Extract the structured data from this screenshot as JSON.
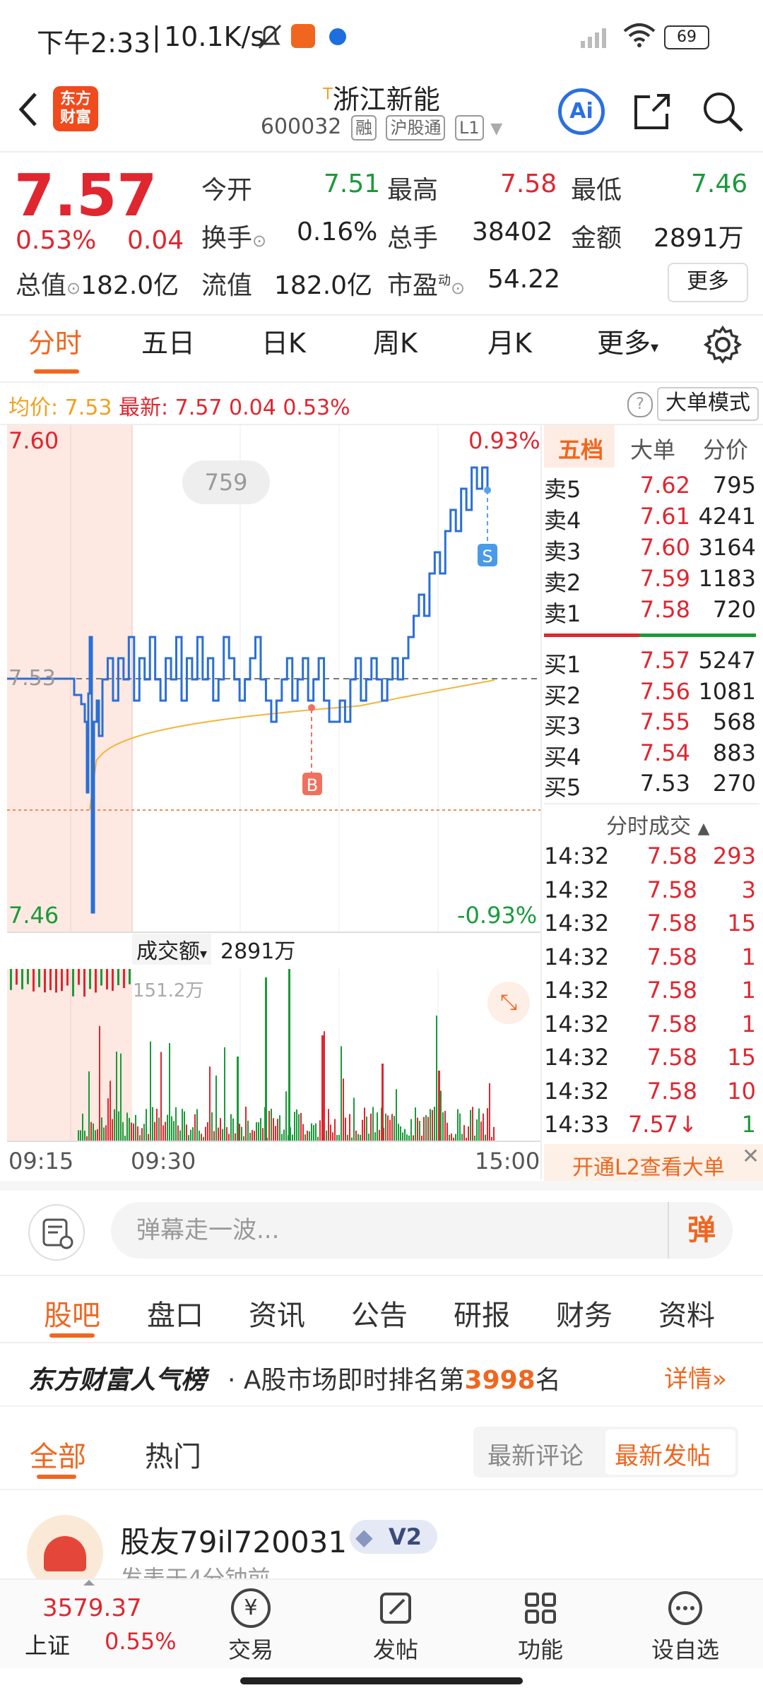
{
  "status_bar": {
    "time": "下午2:33",
    "net_speed": "10.1K/s",
    "battery": "69"
  },
  "header": {
    "logo_line1": "东方",
    "logo_line2": "财富",
    "title_mark": "T",
    "title": "浙江新能",
    "code": "600032",
    "tag_rong": "融",
    "tag_hgt": "沪股通",
    "tag_level": "L1",
    "ai_label": "Ai"
  },
  "quote": {
    "price": "7.57",
    "change_pct": "0.53%",
    "change": "0.04",
    "open_label": "今开",
    "open": "7.51",
    "high_label": "最高",
    "high": "7.58",
    "low_label": "最低",
    "low": "7.46",
    "turnover_label": "换手",
    "turnover": "0.16%",
    "volume_label": "总手",
    "volume": "38402",
    "amount_label": "金额",
    "amount": "2891万",
    "mcap_label": "总值",
    "mcap": "182.0亿",
    "float_label": "流值",
    "float": "182.0亿",
    "pe_label": "市盈",
    "pe_sup": "动",
    "pe": "54.22",
    "more_label": "更多"
  },
  "chart_tabs": [
    "分时",
    "五日",
    "日K",
    "周K",
    "月K",
    "更多"
  ],
  "avg_bar": {
    "avg_label": "均价:",
    "avg": "7.53",
    "last_label": "最新:",
    "last": "7.57",
    "chg": "0.04",
    "pct": "0.53%",
    "mode_label": "大单模式"
  },
  "chart": {
    "y_top": "7.60",
    "y_mid": "7.53",
    "y_bot": "7.46",
    "pct_top": "0.93%",
    "pct_bot": "-0.93%",
    "bubble": "759",
    "marker_buy": "B",
    "marker_sell": "S",
    "vol_label": "成交额",
    "vol_total": "2891万",
    "vol_max": "151.2万",
    "x_start": "09:15",
    "x_mid": "09:30",
    "x_end": "15:00"
  },
  "order_tabs": [
    "五档",
    "大单",
    "分价"
  ],
  "asks": [
    {
      "label": "卖5",
      "price": "7.62",
      "vol": "795"
    },
    {
      "label": "卖4",
      "price": "7.61",
      "vol": "4241"
    },
    {
      "label": "卖3",
      "price": "7.60",
      "vol": "3164"
    },
    {
      "label": "卖2",
      "price": "7.59",
      "vol": "1183"
    },
    {
      "label": "卖1",
      "price": "7.58",
      "vol": "720"
    }
  ],
  "bids": [
    {
      "label": "买1",
      "price": "7.57",
      "vol": "5247"
    },
    {
      "label": "买2",
      "price": "7.56",
      "vol": "1081"
    },
    {
      "label": "买3",
      "price": "7.55",
      "vol": "568"
    },
    {
      "label": "买4",
      "price": "7.54",
      "vol": "883"
    },
    {
      "label": "买5",
      "price": "7.53",
      "vol": "270"
    }
  ],
  "trades_title": "分时成交",
  "trades": [
    {
      "time": "14:32",
      "price": "7.58",
      "vol": "293"
    },
    {
      "time": "14:32",
      "price": "7.58",
      "vol": "3"
    },
    {
      "time": "14:32",
      "price": "7.58",
      "vol": "15"
    },
    {
      "time": "14:32",
      "price": "7.58",
      "vol": "1"
    },
    {
      "time": "14:32",
      "price": "7.58",
      "vol": "1"
    },
    {
      "time": "14:32",
      "price": "7.58",
      "vol": "1"
    },
    {
      "time": "14:32",
      "price": "7.58",
      "vol": "15"
    },
    {
      "time": "14:32",
      "price": "7.58",
      "vol": "10"
    },
    {
      "time": "14:33",
      "price": "7.57↓",
      "vol": "1"
    }
  ],
  "l2_banner": "开通L2查看大单",
  "comment_bar": {
    "placeholder": "弹幕走一波...",
    "danmu": "弹"
  },
  "bottom_tabs": [
    "股吧",
    "盘口",
    "资讯",
    "公告",
    "研报",
    "财务",
    "资料"
  ],
  "rank": {
    "title": "东方财富人气榜",
    "text_pre": "· A股市场即时排名第",
    "number": "3998",
    "text_post": "名",
    "detail": "详情"
  },
  "feed_tabs": [
    "全部",
    "热门"
  ],
  "sort_tabs": [
    "最新评论",
    "最新发帖"
  ],
  "post": {
    "user": "股友79il720031",
    "level": "V2",
    "time_partial": "发表于4分钟前"
  },
  "bottom_nav": {
    "index_value": "3579.37",
    "index_name": "上证",
    "index_pct": "0.55%",
    "items": [
      "交易",
      "发帖",
      "功能",
      "设自选"
    ],
    "trade_icon_char": "¥"
  },
  "colors": {
    "up": "#e0262f",
    "down": "#1a9a3a",
    "accent": "#f0661f",
    "line": "#2a6fd6",
    "avg": "#f2b63b"
  }
}
